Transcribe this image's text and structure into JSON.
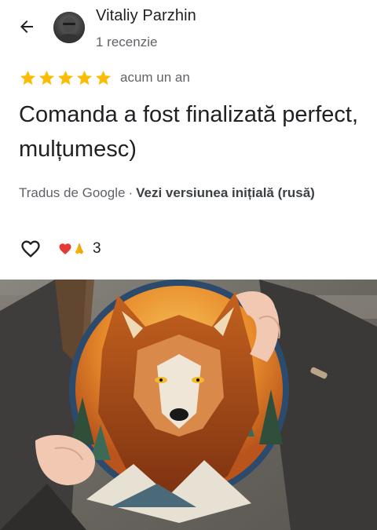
{
  "reviewer": {
    "name": "Vitaliy Parzhin",
    "meta": "1 recenzie"
  },
  "review": {
    "rating": 5,
    "rating_max": 5,
    "time": "acum un an",
    "text": "Comanda a fost finalizată perfect, mulțumesc)",
    "translated_by": "Tradus de Google",
    "separator": "·",
    "original_link": "Vezi versiunea inițială (rusă)"
  },
  "reactions": {
    "count": "3",
    "icons": [
      "heart-icon",
      "praying-hands-icon"
    ]
  },
  "icons": {
    "back": "arrow-left-icon",
    "like": "heart-outline-icon"
  },
  "colors": {
    "star": "#FBBC04",
    "text_primary": "#202124",
    "text_secondary": "#5f6368",
    "reaction_heart": "#E53935"
  }
}
